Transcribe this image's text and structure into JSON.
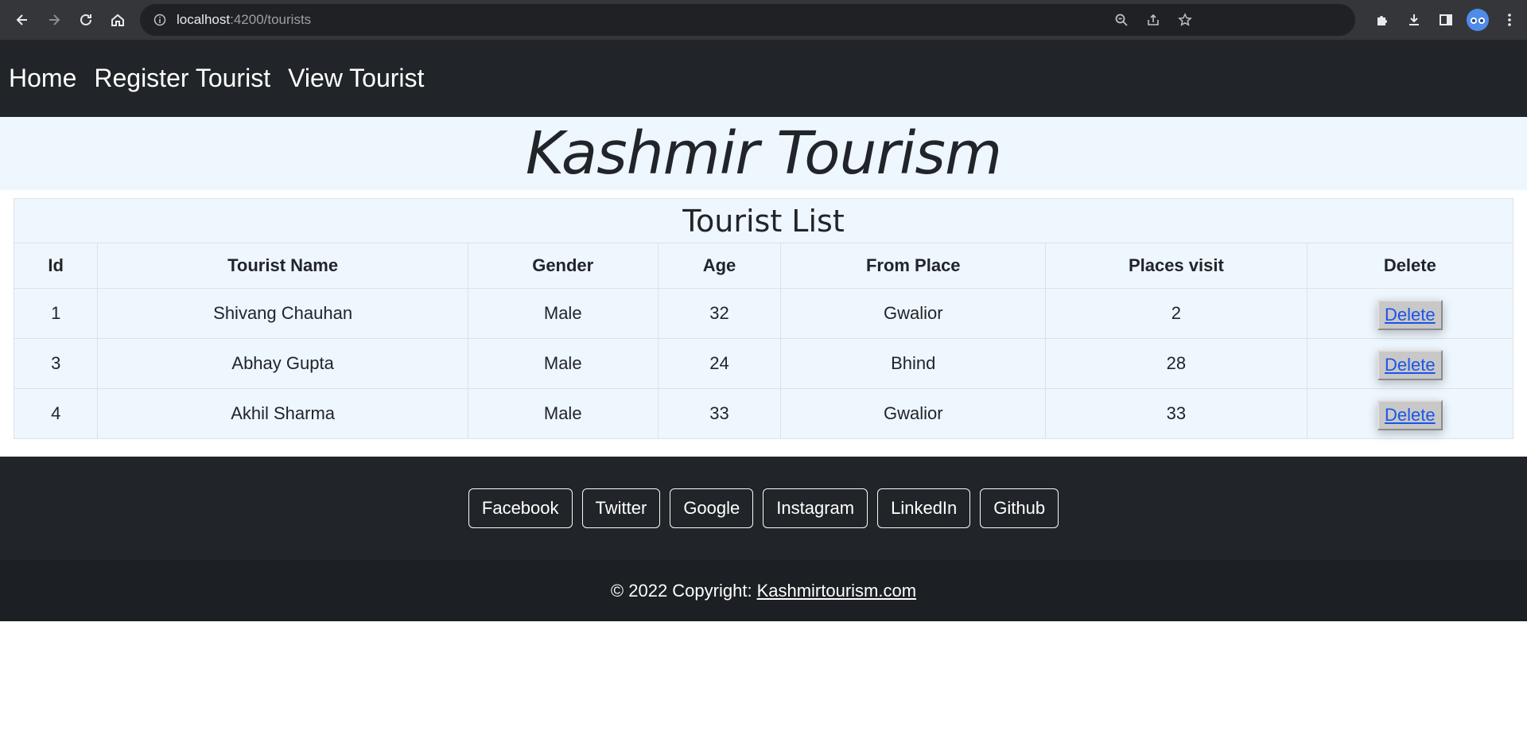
{
  "browser": {
    "url_host": "localhost",
    "url_path": ":4200/tourists"
  },
  "nav": {
    "items": [
      "Home",
      "Register Tourist",
      "View Tourist"
    ]
  },
  "hero": {
    "title": "Kashmir Tourism"
  },
  "table": {
    "caption": "Tourist List",
    "headers": [
      "Id",
      "Tourist Name",
      "Gender",
      "Age",
      "From Place",
      "Places visit",
      "Delete"
    ],
    "rows": [
      {
        "id": "1",
        "name": "Shivang Chauhan",
        "gender": "Male",
        "age": "32",
        "from": "Gwalior",
        "places": "2",
        "delete": "Delete"
      },
      {
        "id": "3",
        "name": "Abhay Gupta",
        "gender": "Male",
        "age": "24",
        "from": "Bhind",
        "places": "28",
        "delete": "Delete"
      },
      {
        "id": "4",
        "name": "Akhil Sharma",
        "gender": "Male",
        "age": "33",
        "from": "Gwalior",
        "places": "33",
        "delete": "Delete"
      }
    ]
  },
  "footer": {
    "social": [
      "Facebook",
      "Twitter",
      "Google",
      "Instagram",
      "LinkedIn",
      "Github"
    ],
    "copyright_prefix": "© 2022 Copyright:",
    "copyright_link": "Kashmirtourism.com"
  },
  "colors": {
    "navbar_bg": "#212529",
    "hero_bg": "#eef6fe",
    "footer_bg": "#212529",
    "link_blue": "#1a55e8"
  }
}
